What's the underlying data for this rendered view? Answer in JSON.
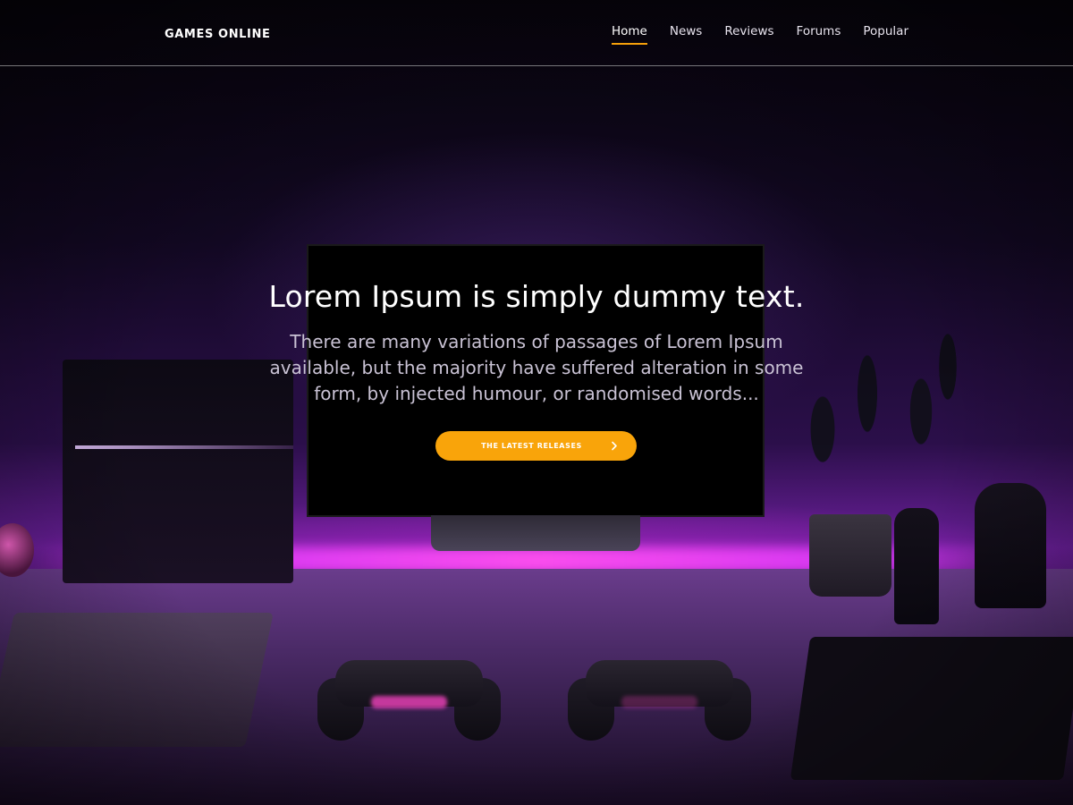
{
  "header": {
    "brand": "GAMES ONLINE",
    "nav": [
      {
        "label": "Home",
        "active": true
      },
      {
        "label": "News",
        "active": false
      },
      {
        "label": "Reviews",
        "active": false
      },
      {
        "label": "Forums",
        "active": false
      },
      {
        "label": "Popular",
        "active": false
      }
    ]
  },
  "hero": {
    "title": "Lorem Ipsum is simply dummy text.",
    "text": "There are many variations of passages of Lorem Ipsum available, but the majority have suffered alteration in some form, by injected humour, or randomised words...",
    "cta_label": "THE LATEST RELEASES",
    "cta_icon": "chevron-right-icon"
  },
  "colors": {
    "accent": "#f9a40a",
    "nav_active_underline": "#f5a00a",
    "background": "#1a0a2c"
  }
}
